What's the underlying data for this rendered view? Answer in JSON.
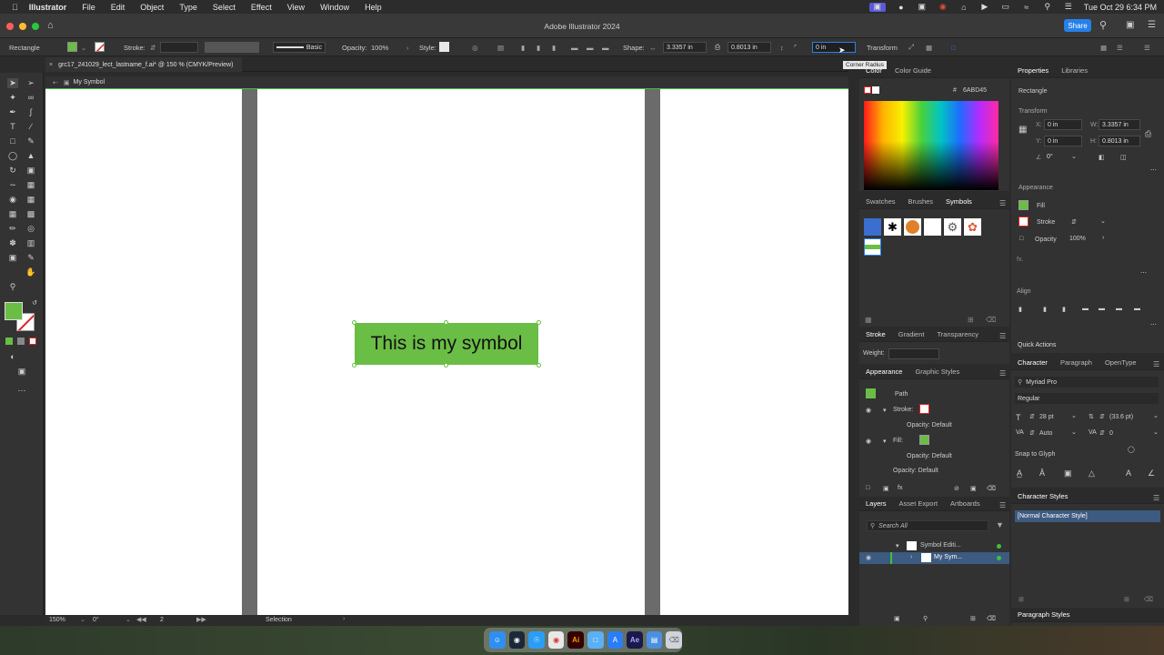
{
  "menubar": {
    "app": "Illustrator",
    "items": [
      "File",
      "Edit",
      "Object",
      "Type",
      "Select",
      "Effect",
      "View",
      "Window",
      "Help"
    ],
    "clock": "Tue Oct 29  6:34 PM"
  },
  "titlebar": {
    "title": "Adobe Illustrator 2024",
    "share": "Share"
  },
  "control": {
    "object_type": "Rectangle",
    "stroke_label": "Stroke:",
    "brush": "Basic",
    "opacity_label": "Opacity:",
    "opacity": "100%",
    "style_label": "Style:",
    "shape_label": "Shape:",
    "width": "3.3357 in",
    "height": "0.8013 in",
    "corner": "0 in",
    "tooltip": "Corner Radius",
    "transform": "Transform"
  },
  "document": {
    "tab": "grc17_241029_lect_lastname_f.ai* @ 150 % (CMYK/Preview)",
    "breadcrumb": "My Symbol"
  },
  "canvas": {
    "symbol_text": "This is my symbol",
    "fill": "#6abd45"
  },
  "status": {
    "zoom": "150%",
    "rotate": "0°",
    "artboard": "2",
    "tool": "Selection"
  },
  "color_panel": {
    "tabs": [
      "Color",
      "Color Guide"
    ],
    "hex": "6ABD45"
  },
  "swatch_panel": {
    "tabs": [
      "Swatches",
      "Brushes",
      "Symbols"
    ]
  },
  "stroke_panel": {
    "tabs": [
      "Stroke",
      "Gradient",
      "Transparency"
    ],
    "weight_label": "Weight:"
  },
  "appearance_panel": {
    "tabs": [
      "Appearance",
      "Graphic Styles"
    ],
    "object": "Path",
    "stroke": "Stroke:",
    "opacity1": "Opacity: Default",
    "fill": "Fill:",
    "opacity2": "Opacity: Default",
    "opacity3": "Opacity: Default"
  },
  "layers_panel": {
    "tabs": [
      "Layers",
      "Asset Export",
      "Artboards"
    ],
    "search": "Search All",
    "layer1": "Symbol Editi...",
    "layer2": "My Sym..."
  },
  "properties": {
    "tabs": [
      "Properties",
      "Libraries"
    ],
    "type": "Rectangle",
    "transform": "Transform",
    "x": "0 in",
    "y": "0 in",
    "w": "3.3357 in",
    "h": "0.8013 in",
    "angle": "0°",
    "appearance": "Appearance",
    "fill": "Fill",
    "stroke": "Stroke",
    "opacity_label": "Opacity",
    "opacity": "100%",
    "align": "Align",
    "quick_actions": "Quick Actions"
  },
  "character": {
    "tabs": [
      "Character",
      "Paragraph",
      "OpenType"
    ],
    "font": "Myriad Pro",
    "style": "Regular",
    "size": "28 pt",
    "leading": "(33.6 pt)",
    "auto": "Auto",
    "tracking": "0",
    "snap": "Snap to Glyph"
  },
  "char_styles": {
    "title": "Character Styles",
    "item": "[Normal Character Style]"
  },
  "para_styles": {
    "title": "Paragraph Styles"
  }
}
